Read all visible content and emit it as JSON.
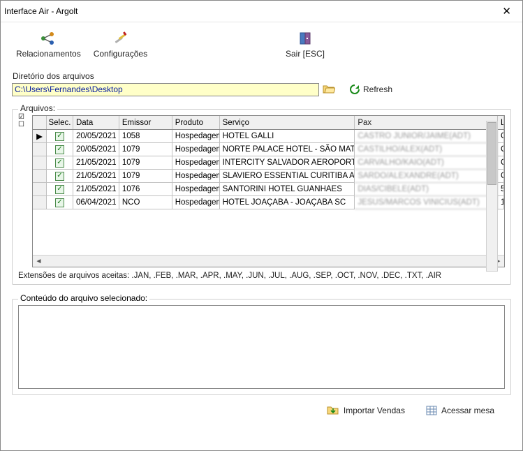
{
  "window": {
    "title": "Interface Air - Argolt"
  },
  "toolbar": {
    "relacionamentos": "Relacionamentos",
    "configuracoes": "Configurações",
    "sair": "Sair [ESC]"
  },
  "directory": {
    "label": "Diretório dos arquivos",
    "path": "C:\\Users\\Fernandes\\Desktop",
    "refresh": "Refresh"
  },
  "files": {
    "legend": "Arquivos:",
    "columns": {
      "selec": "Selec.",
      "data": "Data",
      "emissor": "Emissor",
      "produto": "Produto",
      "servico": "Serviço",
      "pax": "Pax",
      "last": "L"
    },
    "rows": [
      {
        "data": "20/05/2021",
        "emissor": "1058",
        "produto": "Hospedagem",
        "servico": "HOTEL GALLI",
        "pax": "CASTRO JUNIOR/JAIME(ADT)",
        "c": "C"
      },
      {
        "data": "20/05/2021",
        "emissor": "1079",
        "produto": "Hospedagem",
        "servico": "NORTE PALACE HOTEL - SÃO MATEUS",
        "pax": "CASTILHO/ALEX(ADT)",
        "c": "C"
      },
      {
        "data": "21/05/2021",
        "emissor": "1079",
        "produto": "Hospedagem",
        "servico": "INTERCITY SALVADOR AEROPORTO (I",
        "pax": "CARVALHO/KAIO(ADT)",
        "c": "C"
      },
      {
        "data": "21/05/2021",
        "emissor": "1079",
        "produto": "Hospedagem",
        "servico": "SLAVIERO ESSENTIAL CURITIBA AER",
        "pax": "SARDO/ALEXANDRE(ADT)",
        "c": "C"
      },
      {
        "data": "21/05/2021",
        "emissor": "1076",
        "produto": "Hospedagem",
        "servico": "SANTORINI HOTEL GUANHAES",
        "pax": "DIAS/CIBELE(ADT)",
        "c": "5"
      },
      {
        "data": "06/04/2021",
        "emissor": "NCO",
        "produto": "Hospedagem",
        "servico": "HOTEL JOAÇABA - JOAÇABA SC",
        "pax": "JESUS/MARCOS VINICIUS(ADT)",
        "c": "1"
      }
    ],
    "extensions": "Extensões de arquivos aceitas: .JAN, .FEB, .MAR, .APR, .MAY, .JUN, .JUL, .AUG, .SEP, .OCT, .NOV, .DEC, .TXT, .AIR"
  },
  "selectedContent": {
    "legend": "Conteúdo do arquivo selecionado:"
  },
  "footer": {
    "importar": "Importar Vendas",
    "acessar": "Acessar mesa"
  }
}
